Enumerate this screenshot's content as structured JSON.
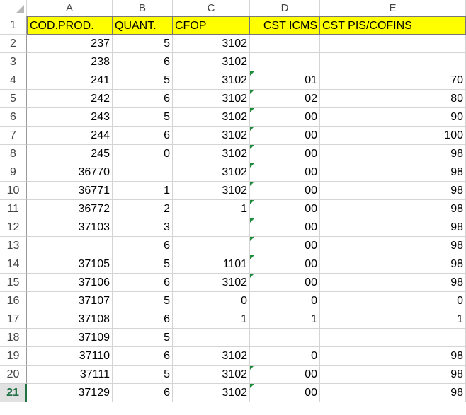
{
  "columns": [
    "A",
    "B",
    "C",
    "D",
    "E"
  ],
  "rows": [
    {
      "n": "1",
      "cells": [
        "COD.PROD.",
        "QUANT.",
        "CFOP",
        "CST ICMS",
        "CST PIS/COFINS"
      ],
      "header": true
    },
    {
      "n": "2",
      "cells": [
        "237",
        "5",
        "3102",
        "",
        ""
      ]
    },
    {
      "n": "3",
      "cells": [
        "238",
        "6",
        "3102",
        "",
        ""
      ]
    },
    {
      "n": "4",
      "cells": [
        "241",
        "5",
        "3102",
        "01",
        "70"
      ]
    },
    {
      "n": "5",
      "cells": [
        "242",
        "6",
        "3102",
        "02",
        "80"
      ]
    },
    {
      "n": "6",
      "cells": [
        "243",
        "5",
        "3102",
        "00",
        "90"
      ]
    },
    {
      "n": "7",
      "cells": [
        "244",
        "6",
        "3102",
        "00",
        "100"
      ]
    },
    {
      "n": "8",
      "cells": [
        "245",
        "0",
        "3102",
        "00",
        "98"
      ]
    },
    {
      "n": "9",
      "cells": [
        "36770",
        "",
        "3102",
        "00",
        "98"
      ]
    },
    {
      "n": "10",
      "cells": [
        "36771",
        "1",
        "3102",
        "00",
        "98"
      ]
    },
    {
      "n": "11",
      "cells": [
        "36772",
        "2",
        "1",
        "00",
        "98"
      ]
    },
    {
      "n": "12",
      "cells": [
        "37103",
        "3",
        "",
        "00",
        "98"
      ]
    },
    {
      "n": "13",
      "cells": [
        "",
        "6",
        "",
        "00",
        "98"
      ]
    },
    {
      "n": "14",
      "cells": [
        "37105",
        "5",
        "1101",
        "00",
        "98"
      ]
    },
    {
      "n": "15",
      "cells": [
        "37106",
        "6",
        "3102",
        "00",
        "98"
      ]
    },
    {
      "n": "16",
      "cells": [
        "37107",
        "5",
        "0",
        "0",
        "0"
      ]
    },
    {
      "n": "17",
      "cells": [
        "37108",
        "6",
        "1",
        "1",
        "1"
      ]
    },
    {
      "n": "18",
      "cells": [
        "37109",
        "5",
        "",
        "",
        ""
      ]
    },
    {
      "n": "19",
      "cells": [
        "37110",
        "6",
        "3102",
        "0",
        "98"
      ]
    },
    {
      "n": "20",
      "cells": [
        "37111",
        "5",
        "3102",
        "00",
        "98"
      ]
    },
    {
      "n": "21",
      "cells": [
        "37129",
        "6",
        "3102",
        "00",
        "98"
      ],
      "active": true
    }
  ],
  "flagged_d_rows": [
    "4",
    "5",
    "6",
    "7",
    "8",
    "9",
    "10",
    "11",
    "12",
    "13",
    "14",
    "15",
    "20",
    "21"
  ],
  "colors": {
    "header_fill": "#ffff00",
    "error_flag": "#1e8c3a",
    "active_row": "#217346"
  }
}
